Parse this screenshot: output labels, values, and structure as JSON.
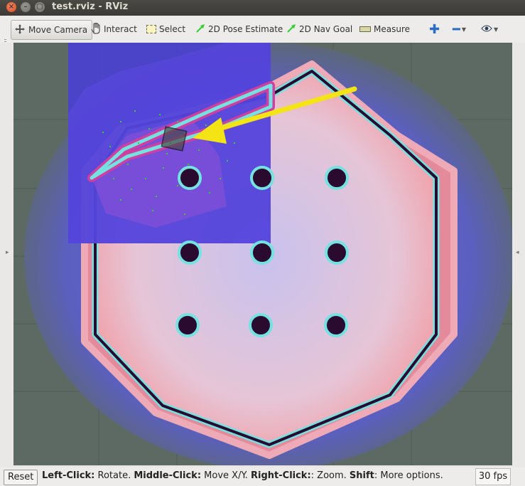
{
  "window": {
    "title": "test.rviz - RViz"
  },
  "toolbar": {
    "move_camera": "Move Camera",
    "interact": "Interact",
    "select": "Select",
    "pose_estimate": "2D Pose Estimate",
    "nav_goal": "2D Nav Goal",
    "measure": "Measure"
  },
  "status": {
    "reset": "Reset",
    "help_1_key": "Left-Click:",
    "help_1_val": " Rotate. ",
    "help_2_key": "Middle-Click:",
    "help_2_val": " Move X/Y. ",
    "help_3_key": "Right-Click:",
    "help_3_val": ": Zoom. ",
    "help_4_key": "Shift",
    "help_4_val": ": More options.",
    "fps": "30 fps"
  },
  "colors": {
    "accent": "#2b6cc4",
    "arrow": "#f4e415",
    "pose_green": "#2fd12f"
  }
}
